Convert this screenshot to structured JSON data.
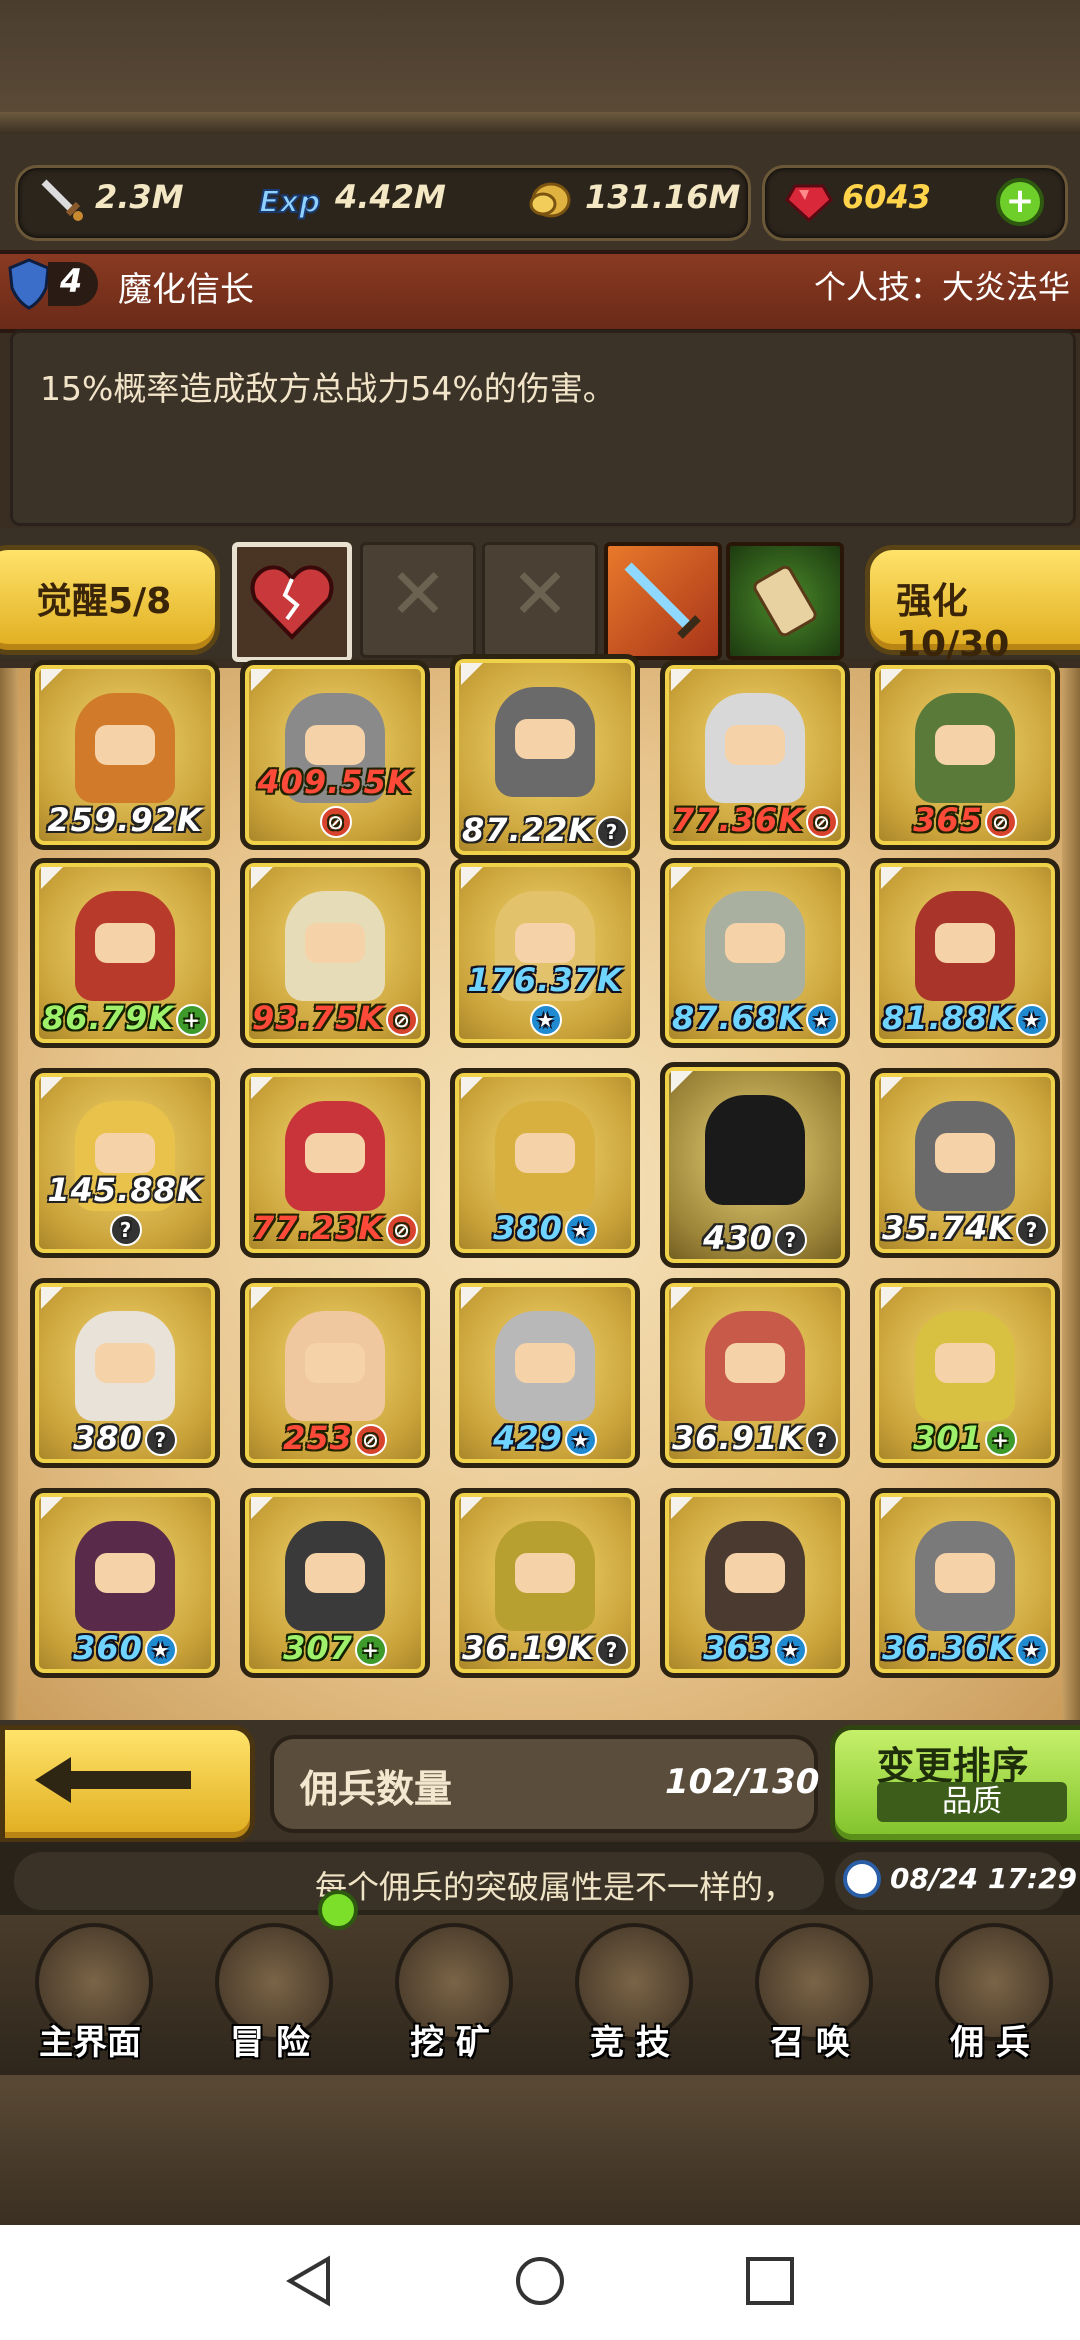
{
  "resources": {
    "attack": "2.3M",
    "exp": "4.42M",
    "gold": "131.16M",
    "gems": "6043"
  },
  "hero": {
    "level": "4",
    "name": "魔化信长",
    "skill": "个人技：大炎法华",
    "description": "15%概率造成敌方总战力54%的伤害。"
  },
  "awaken": {
    "awaken_label": "觉醒5/8",
    "enhance_label": "强化10/30"
  },
  "mercenaries": [
    {
      "power": "259.92K",
      "badge": "",
      "color": "white"
    },
    {
      "power": "409.55K",
      "badge": "r",
      "color": "red"
    },
    {
      "power": "87.22K",
      "badge": "q",
      "color": "white"
    },
    {
      "power": "77.36K",
      "badge": "r",
      "color": "red"
    },
    {
      "power": "365",
      "badge": "r",
      "color": "red"
    },
    {
      "power": "86.79K",
      "badge": "g",
      "color": "green"
    },
    {
      "power": "93.75K",
      "badge": "r",
      "color": "red"
    },
    {
      "power": "176.37K",
      "badge": "b",
      "color": "blue"
    },
    {
      "power": "87.68K",
      "badge": "b",
      "color": "blue"
    },
    {
      "power": "81.88K",
      "badge": "b",
      "color": "blue"
    },
    {
      "power": "145.88K",
      "badge": "q",
      "color": "white"
    },
    {
      "power": "77.23K",
      "badge": "r",
      "color": "red"
    },
    {
      "power": "380",
      "badge": "b",
      "color": "blue"
    },
    {
      "power": "430",
      "badge": "q",
      "color": "white"
    },
    {
      "power": "35.74K",
      "badge": "q",
      "color": "white"
    },
    {
      "power": "380",
      "badge": "q",
      "color": "white"
    },
    {
      "power": "253",
      "badge": "r",
      "color": "red"
    },
    {
      "power": "429",
      "badge": "b",
      "color": "blue"
    },
    {
      "power": "36.91K",
      "badge": "q",
      "color": "white"
    },
    {
      "power": "301",
      "badge": "g",
      "color": "green"
    },
    {
      "power": "360",
      "badge": "b",
      "color": "blue"
    },
    {
      "power": "307",
      "badge": "g",
      "color": "green"
    },
    {
      "power": "36.19K",
      "badge": "q",
      "color": "white"
    },
    {
      "power": "363",
      "badge": "b",
      "color": "blue"
    },
    {
      "power": "36.36K",
      "badge": "b",
      "color": "blue"
    }
  ],
  "footer": {
    "count_label": "佣兵数量",
    "count_value": "102/130",
    "sort_label": "变更排序",
    "sort_sub": "品质",
    "ticker": "每个佣兵的突破属性是不一样的，",
    "datetime": "08/24 17:29"
  },
  "nav": [
    {
      "label": "主界面",
      "icon": "map-scroll-icon"
    },
    {
      "label": "冒 险",
      "icon": "island-icon"
    },
    {
      "label": "挖 矿",
      "icon": "pickaxe-icon"
    },
    {
      "label": "竞 技",
      "icon": "crossed-swords-icon"
    },
    {
      "label": "召 唤",
      "icon": "scroll-icon"
    },
    {
      "label": "佣 兵",
      "icon": "tent-icon"
    }
  ]
}
